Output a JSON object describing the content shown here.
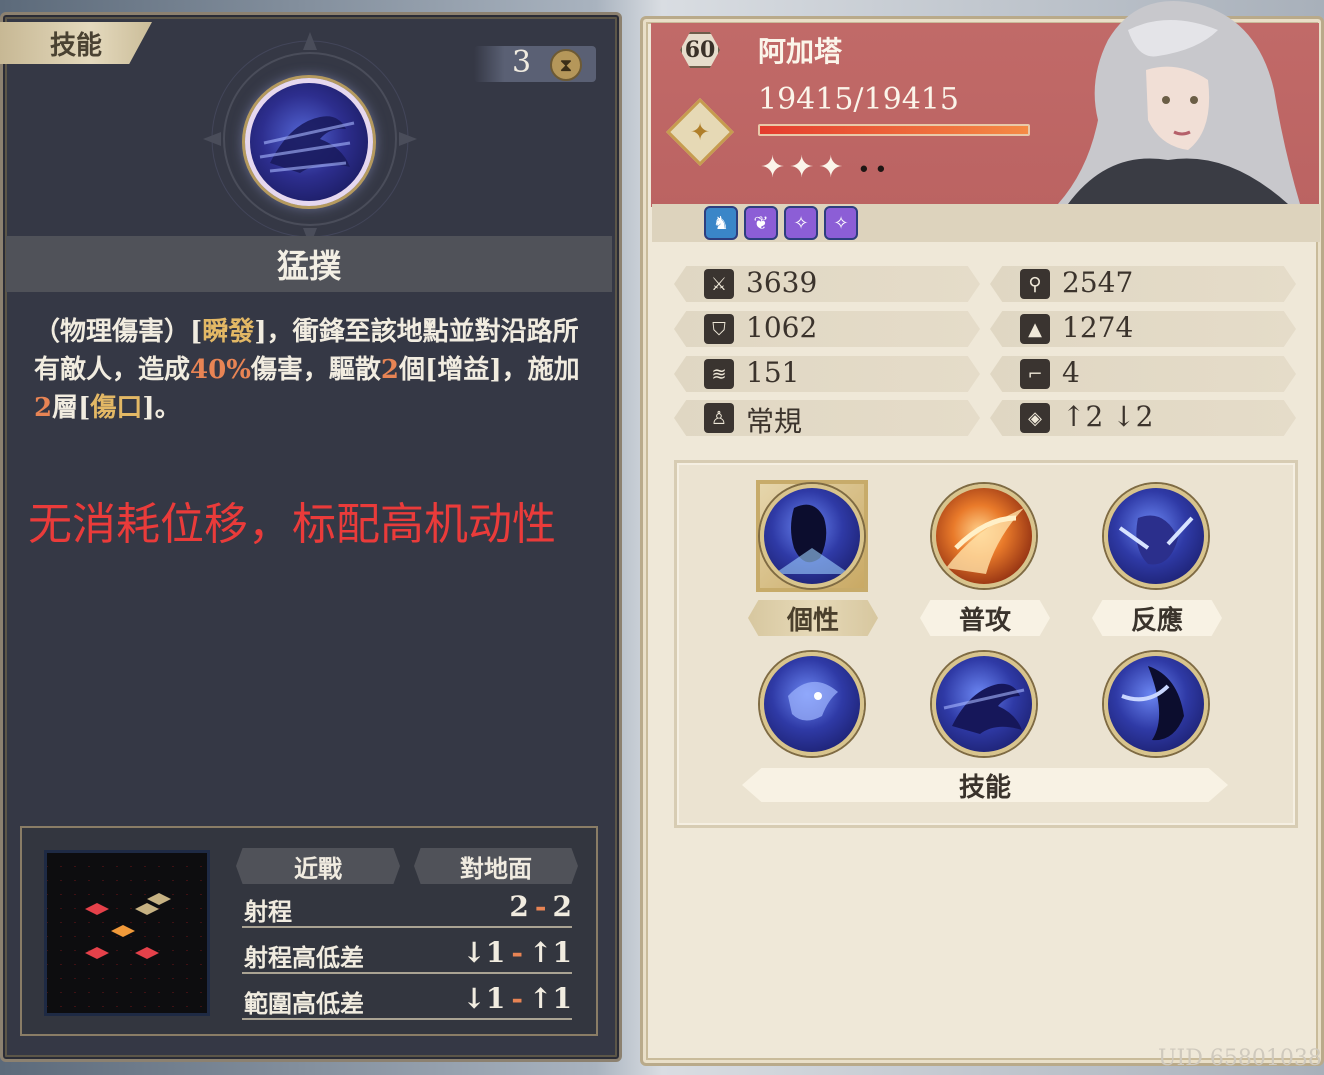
{
  "skill_panel": {
    "tag": "技能",
    "cost": "3",
    "skill_name": "猛撲",
    "description": {
      "p1": "（物理傷害）[",
      "instant": "瞬發",
      "p2": "]，衝鋒至該地點並對沿路所有敵人，造成",
      "damage": "40%",
      "p3": "傷害，驅散",
      "dispel_count": "2",
      "p4": "個[增益]，施加",
      "stack_count": "2",
      "p5": "層[",
      "wound": "傷口",
      "p6": "]。"
    },
    "note": "无消耗位移，标配高机动性",
    "attack_type": "近戰",
    "target_type": "對地面",
    "range_rows": [
      {
        "label": "射程",
        "min": "2",
        "max": "2"
      },
      {
        "label": "射程高低差",
        "min": "↓1",
        "max": "↑1"
      },
      {
        "label": "範圍高低差",
        "min": "↓1",
        "max": "↑1"
      }
    ]
  },
  "character": {
    "level": "60",
    "name": "阿加塔",
    "hp": "19415/19415",
    "hp_fraction": 1.0,
    "stars_filled": "✦✦✦",
    "stars_empty": "••",
    "stats": [
      {
        "icon": "sword-icon",
        "value": "3639"
      },
      {
        "icon": "magic-wand-icon",
        "value": "2547"
      },
      {
        "icon": "shield-icon",
        "value": "1062"
      },
      {
        "icon": "wizard-hat-icon",
        "value": "1274"
      },
      {
        "icon": "wing-icon",
        "value": "151"
      },
      {
        "icon": "boot-icon",
        "value": "4"
      },
      {
        "icon": "movement-type-icon",
        "value": "常規"
      },
      {
        "icon": "height-icon",
        "value": "↑2 ↓2"
      }
    ],
    "tabs": {
      "trait": "個性",
      "basic_attack": "普攻",
      "reaction": "反應",
      "skills": "技能"
    }
  },
  "uid": "UID 65801038"
}
